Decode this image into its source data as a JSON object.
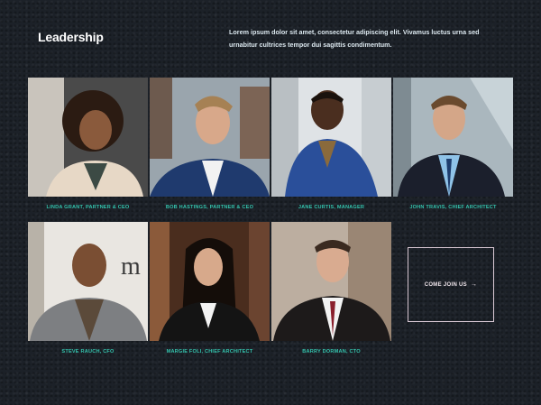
{
  "section": {
    "title": "Leadership",
    "intro": "Lorem ipsum dolor sit amet, consectetur adipiscing elit. Vivamus luctus urna sed urnabitur cultrices tempor dui sagittis condimentum."
  },
  "team": [
    {
      "name_role": "LINDA GRANT, partner & CEO"
    },
    {
      "name_role": "BOB HASTINGS, partner & CEO"
    },
    {
      "name_role": "JANE CURTIS, Manager"
    },
    {
      "name_role": "JOHN TRAVIS, Chief Architect"
    },
    {
      "name_role": "STEVE RAUCH, CFO"
    },
    {
      "name_role": "MARGIE FOLI, Chief Architect"
    },
    {
      "name_role": "BARRY DORMAN, CTO"
    }
  ],
  "cta": {
    "label": "COME JOIN US",
    "icon": "arrow-right-icon"
  },
  "colors": {
    "background": "#1c2128",
    "caption": "#34c3ad",
    "title": "#ffffff"
  }
}
